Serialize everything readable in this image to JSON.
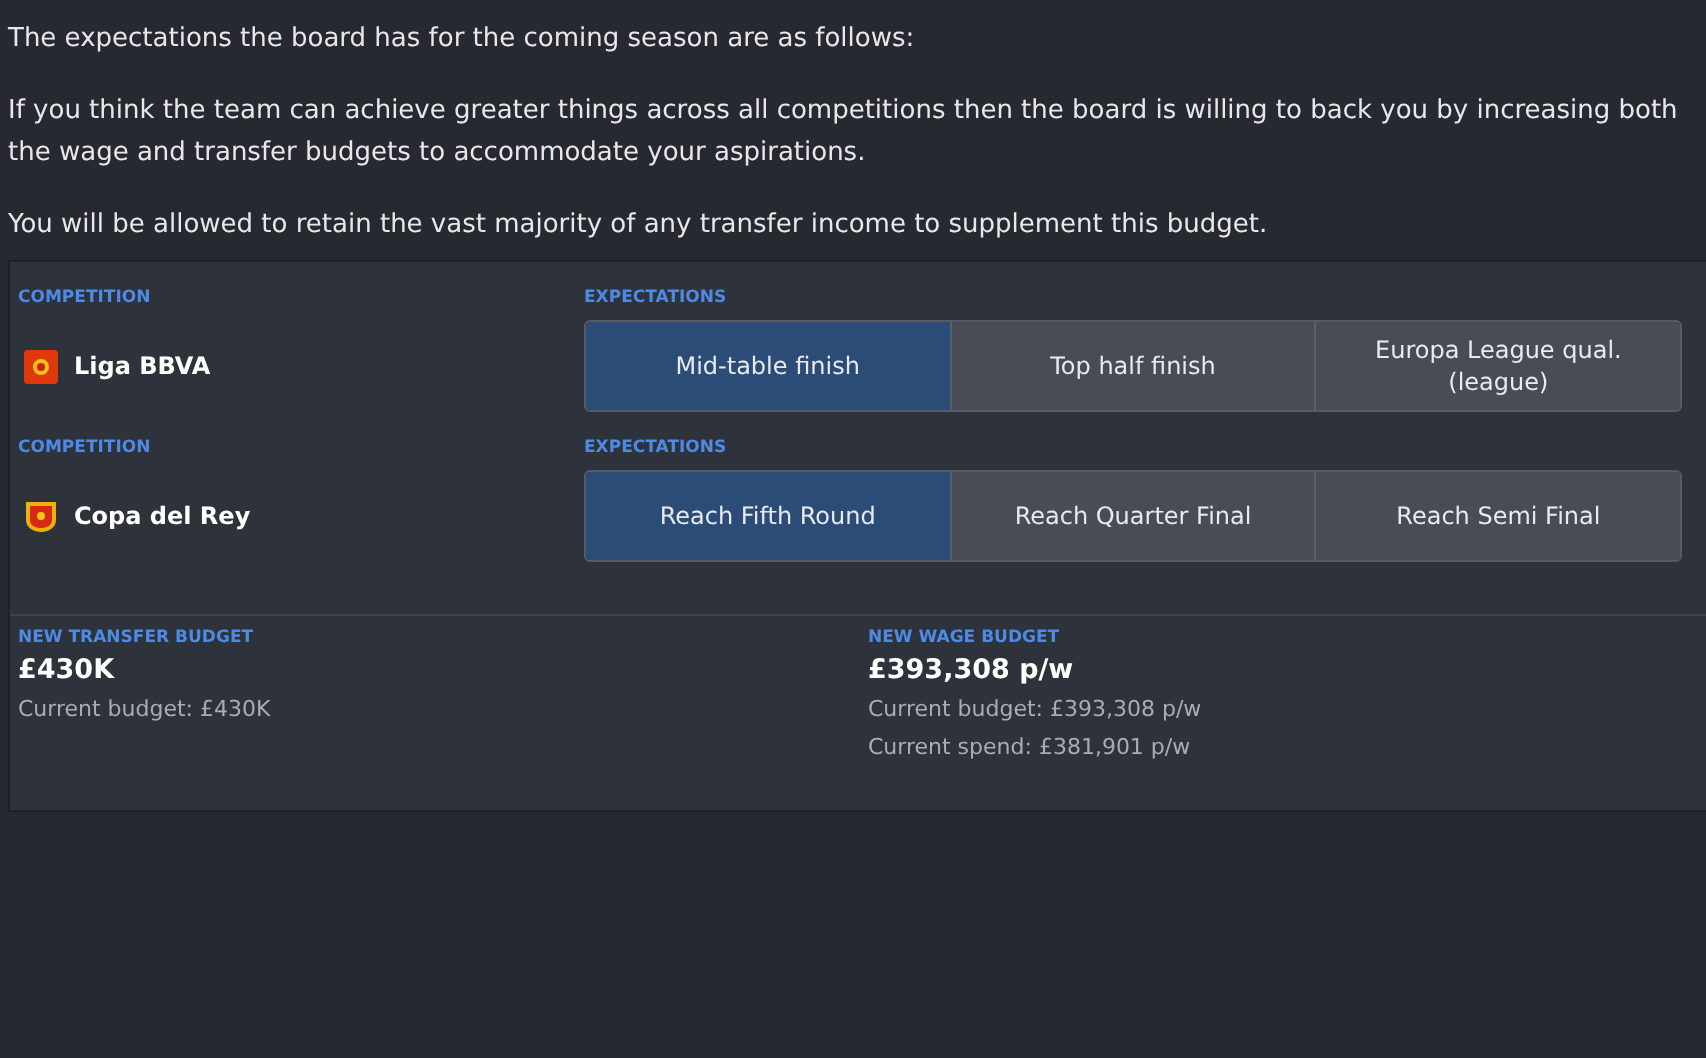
{
  "intro": [
    "The expectations the board has for the coming season are as follows:",
    "If you think the team can achieve greater things across all competitions then the board is willing to back you by increasing both the wage and transfer budgets to accommodate your aspirations.",
    "You will be allowed to retain the vast majority of any transfer income to supplement this budget."
  ],
  "competitions": [
    {
      "heading": "COMPETITION",
      "expectations_heading": "EXPECTATIONS",
      "name": "Liga BBVA",
      "kind": "league",
      "options": [
        {
          "label": "Mid-table finish",
          "selected": true
        },
        {
          "label": "Top half finish",
          "selected": false
        },
        {
          "label": "Europa League qual. (league)",
          "selected": false
        }
      ]
    },
    {
      "heading": "COMPETITION",
      "expectations_heading": "EXPECTATIONS",
      "name": "Copa del Rey",
      "kind": "cup",
      "options": [
        {
          "label": "Reach Fifth Round",
          "selected": true
        },
        {
          "label": "Reach Quarter Final",
          "selected": false
        },
        {
          "label": "Reach Semi Final",
          "selected": false
        }
      ]
    }
  ],
  "budgets": [
    {
      "heading": "NEW TRANSFER BUDGET",
      "value": "£430K",
      "details": [
        "Current budget: £430K"
      ]
    },
    {
      "heading": "NEW WAGE BUDGET",
      "value": "£393,308 p/w",
      "details": [
        "Current budget: £393,308 p/w",
        "Current spend: £381,901 p/w"
      ]
    }
  ]
}
